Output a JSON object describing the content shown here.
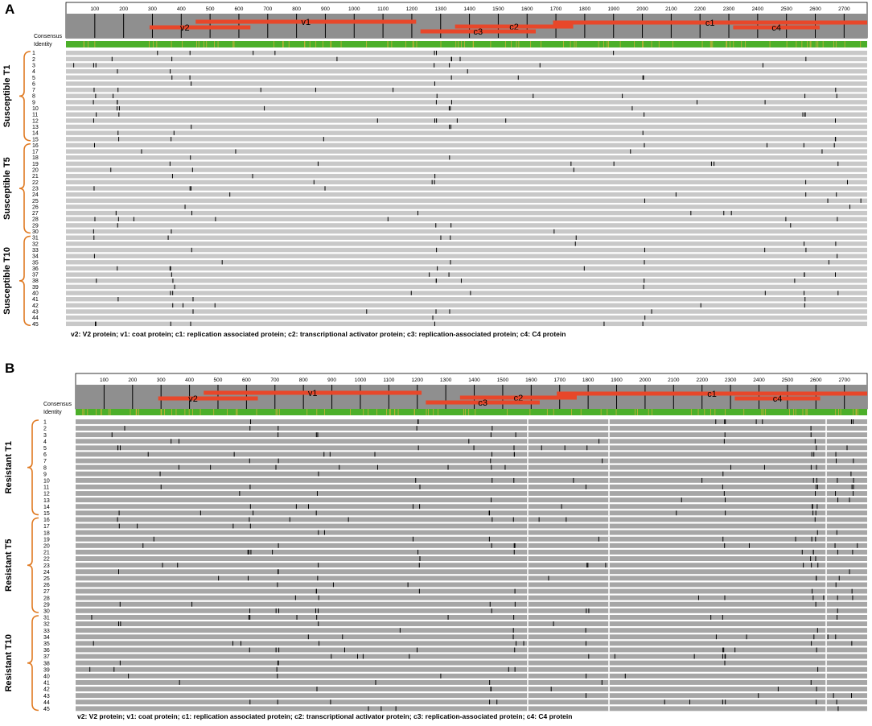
{
  "colors": {
    "identity_bar": "#4caf2a",
    "feature_bar": "#e8472a",
    "track_susceptible": "#c8c8c8",
    "track_resistant": "#a6a6a6",
    "bracket": "#e07a22",
    "ruler_bg": "#8f8f8f"
  },
  "ruler": {
    "ticks": [
      "100",
      "200",
      "300",
      "400",
      "500",
      "600",
      "700",
      "800",
      "900",
      "1000",
      "1100",
      "1200",
      "1300",
      "1400",
      "1500",
      "1600",
      "1700",
      "1800",
      "1900",
      "2000",
      "2100",
      "2200",
      "2300",
      "2400",
      "2500",
      "2600",
      "2700"
    ],
    "max": 2780
  },
  "features": [
    {
      "label": "v1",
      "start": 450,
      "end": 1215
    },
    {
      "label": "v2",
      "start": 290,
      "end": 640
    },
    {
      "label": "c1",
      "start": 1690,
      "end": 2780
    },
    {
      "label": "c2",
      "start": 1350,
      "end": 1760
    },
    {
      "label": "c3",
      "start": 1230,
      "end": 1630
    },
    {
      "label": "c4",
      "start": 2315,
      "end": 2615
    }
  ],
  "labels": {
    "consensus": "Consensus",
    "identity": "Identity"
  },
  "legend_text": "v2: V2 protein; v1: coat protein; c1: replication associated protein; c2: transcriptional activator protein; c3: replication-associated protein; c4: C4 protein",
  "panels": [
    {
      "letter": "A",
      "rows": [
        "1",
        "2",
        "3",
        "4",
        "5",
        "6",
        "7",
        "8",
        "9",
        "10",
        "11",
        "12",
        "13",
        "14",
        "15",
        "16",
        "17",
        "18",
        "19",
        "20",
        "21",
        "22",
        "23",
        "24",
        "25",
        "26",
        "27",
        "28",
        "29",
        "30",
        "31",
        "32",
        "33",
        "34",
        "35",
        "36",
        "37",
        "38",
        "39",
        "40",
        "41",
        "42",
        "43",
        "44",
        "45"
      ],
      "groups": [
        {
          "label": "Susceptible T1",
          "from": 1,
          "to": 15
        },
        {
          "label": "Susceptible T5",
          "from": 16,
          "to": 30
        },
        {
          "label": "Susceptible T10",
          "from": 31,
          "to": 45
        }
      ]
    },
    {
      "letter": "B",
      "rows": [
        "1",
        "2",
        "3",
        "4",
        "5",
        "6",
        "7",
        "8",
        "9",
        "10",
        "11",
        "12",
        "13",
        "14",
        "15",
        "16",
        "17",
        "18",
        "19",
        "20",
        "21",
        "22",
        "23",
        "24",
        "25",
        "26",
        "27",
        "28",
        "29",
        "30",
        "31",
        "32",
        "33",
        "34",
        "35",
        "36",
        "37",
        "38",
        "39",
        "40",
        "41",
        "42",
        "43",
        "44",
        "45"
      ],
      "groups": [
        {
          "label": "Resistant T1",
          "from": 1,
          "to": 15
        },
        {
          "label": "Resistant T5",
          "from": 16,
          "to": 30
        },
        {
          "label": "Resistant T10",
          "from": 31,
          "to": 45
        }
      ]
    }
  ]
}
